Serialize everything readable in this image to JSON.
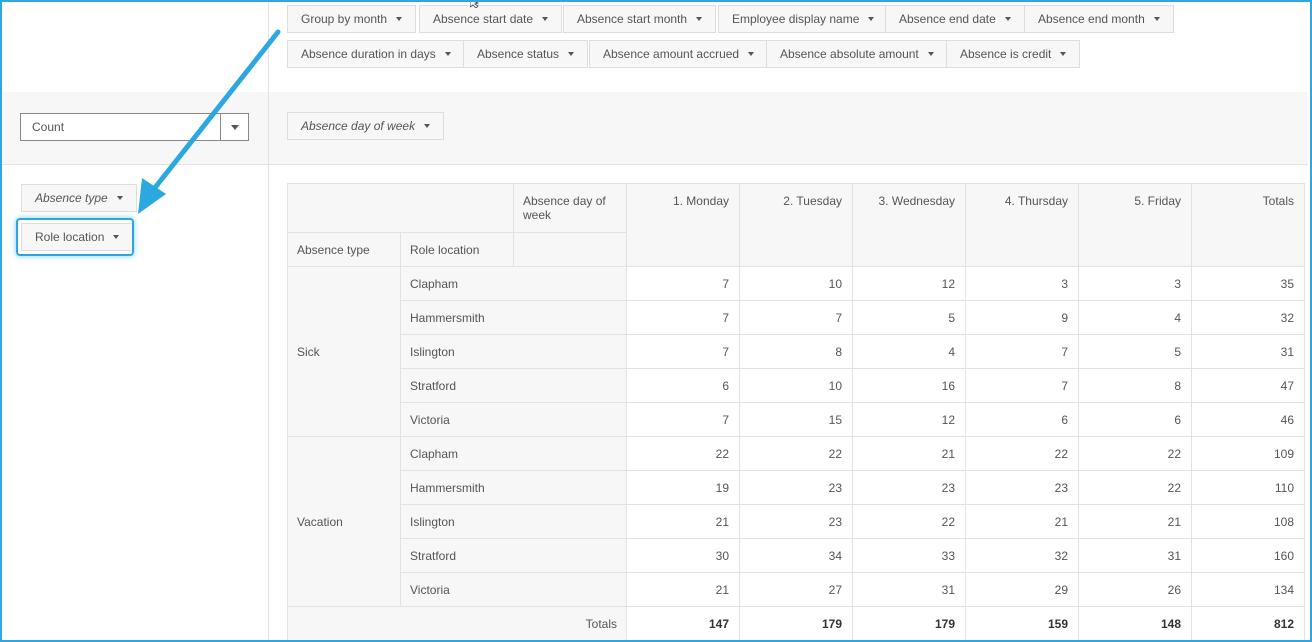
{
  "filters_top": [
    "Group by month",
    "Absence start date",
    "Absence start month",
    "Employee display name",
    "Absence end date",
    "Absence end month"
  ],
  "filters_second": [
    "Absence duration in days",
    "Absence status",
    "Absence amount accrued",
    "Absence absolute amount",
    "Absence is credit"
  ],
  "aggregator": {
    "value": "Count"
  },
  "column_field": "Absence day of week",
  "row_fields": [
    "Absence type",
    "Role location"
  ],
  "table": {
    "col_attr_label": "Absence day of week",
    "row_header_1": "Absence type",
    "row_header_2": "Role location",
    "columns": [
      "1. Monday",
      "2. Tuesday",
      "3. Wednesday",
      "4. Thursday",
      "5. Friday",
      "Totals"
    ],
    "groups": [
      {
        "name": "Sick",
        "rows": [
          {
            "location": "Clapham",
            "values": [
              7,
              10,
              12,
              3,
              3,
              35
            ]
          },
          {
            "location": "Hammersmith",
            "values": [
              7,
              7,
              5,
              9,
              4,
              32
            ]
          },
          {
            "location": "Islington",
            "values": [
              7,
              8,
              4,
              7,
              5,
              31
            ]
          },
          {
            "location": "Stratford",
            "values": [
              6,
              10,
              16,
              7,
              8,
              47
            ]
          },
          {
            "location": "Victoria",
            "values": [
              7,
              15,
              12,
              6,
              6,
              46
            ]
          }
        ]
      },
      {
        "name": "Vacation",
        "rows": [
          {
            "location": "Clapham",
            "values": [
              22,
              22,
              21,
              22,
              22,
              109
            ]
          },
          {
            "location": "Hammersmith",
            "values": [
              19,
              23,
              23,
              23,
              22,
              110
            ]
          },
          {
            "location": "Islington",
            "values": [
              21,
              23,
              22,
              21,
              21,
              108
            ]
          },
          {
            "location": "Stratford",
            "values": [
              30,
              34,
              33,
              32,
              31,
              160
            ]
          },
          {
            "location": "Victoria",
            "values": [
              21,
              27,
              31,
              29,
              26,
              134
            ]
          }
        ]
      }
    ],
    "totals_label": "Totals",
    "totals": [
      147,
      179,
      179,
      159,
      148,
      812
    ]
  },
  "colors": {
    "accent": "#2aa8df",
    "border": "#e2e2e2",
    "band": "#f7f7f7"
  }
}
